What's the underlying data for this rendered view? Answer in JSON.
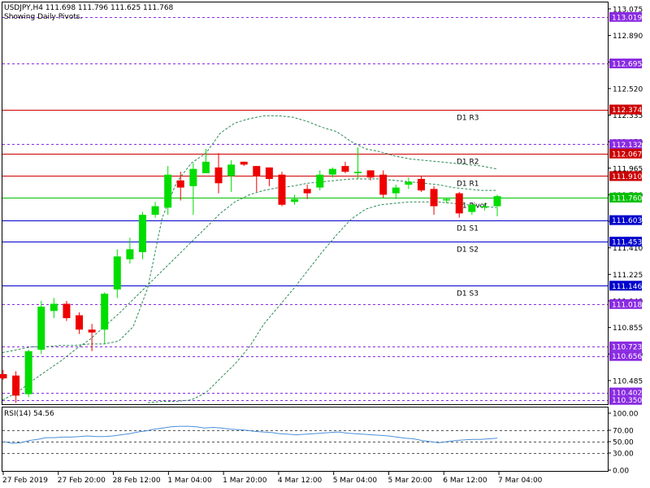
{
  "header": {
    "symbol_line": "USDJPY,H4  111.698 111.796 111.625 111.768",
    "pivot_note": "Showing Daily Pivots.",
    "rsi_label": "RSI(14) 54.56"
  },
  "colors": {
    "bull": "#00dd00",
    "bear": "#ee0000",
    "bollinger": "#2e8b57",
    "pivot_green": "#00c000",
    "support_blue": "#0000cc",
    "resistance_red": "#cc0000",
    "dashed_purple": "#8a2be2",
    "badge_blue": "#0000cc",
    "badge_green": "#00c000",
    "badge_red": "#cc0000",
    "badge_purple": "#8a2be2",
    "rsi_line": "#4a90d9"
  },
  "chart_data": [
    {
      "type": "candlestick",
      "title": "USDJPY,H4",
      "ylim": [
        110.32,
        113.12
      ],
      "y_ticks": [
        "113.075",
        "112.890",
        "112.705",
        "112.520",
        "112.335",
        "112.150",
        "111.965",
        "111.780",
        "111.595",
        "111.410",
        "111.225",
        "111.040",
        "110.855",
        "110.670",
        "110.485"
      ],
      "x_ticks": [
        {
          "label": "27 Feb 2019",
          "index": 0
        },
        {
          "label": "27 Feb 20:00",
          "index": 5
        },
        {
          "label": "28 Feb 12:00",
          "index": 10
        },
        {
          "label": "1 Mar 04:00",
          "index": 15
        },
        {
          "label": "1 Mar 20:00",
          "index": 20
        },
        {
          "label": "4 Mar 12:00",
          "index": 25
        },
        {
          "label": "5 Mar 04:00",
          "index": 30
        },
        {
          "label": "5 Mar 20:00",
          "index": 35
        },
        {
          "label": "6 Mar 12:00",
          "index": 40
        },
        {
          "label": "7 Mar 04:00",
          "index": 45
        }
      ],
      "candles": [
        {
          "o": 110.53,
          "h": 110.56,
          "l": 110.49,
          "c": 110.5
        },
        {
          "o": 110.52,
          "h": 110.55,
          "l": 110.33,
          "c": 110.38
        },
        {
          "o": 110.39,
          "h": 110.7,
          "l": 110.37,
          "c": 110.69
        },
        {
          "o": 110.7,
          "h": 111.04,
          "l": 110.67,
          "c": 111.0
        },
        {
          "o": 110.97,
          "h": 111.06,
          "l": 110.92,
          "c": 111.02
        },
        {
          "o": 111.02,
          "h": 111.04,
          "l": 110.9,
          "c": 110.92
        },
        {
          "o": 110.94,
          "h": 110.96,
          "l": 110.81,
          "c": 110.84
        },
        {
          "o": 110.84,
          "h": 110.88,
          "l": 110.69,
          "c": 110.82
        },
        {
          "o": 110.84,
          "h": 111.1,
          "l": 110.74,
          "c": 111.09
        },
        {
          "o": 111.12,
          "h": 111.4,
          "l": 111.06,
          "c": 111.35
        },
        {
          "o": 111.33,
          "h": 111.48,
          "l": 111.3,
          "c": 111.4
        },
        {
          "o": 111.38,
          "h": 111.66,
          "l": 111.33,
          "c": 111.64
        },
        {
          "o": 111.64,
          "h": 111.73,
          "l": 111.62,
          "c": 111.7
        },
        {
          "o": 111.69,
          "h": 111.98,
          "l": 111.64,
          "c": 111.92
        },
        {
          "o": 111.88,
          "h": 111.94,
          "l": 111.74,
          "c": 111.83
        },
        {
          "o": 111.84,
          "h": 112.0,
          "l": 111.64,
          "c": 111.96
        },
        {
          "o": 111.93,
          "h": 112.1,
          "l": 111.93,
          "c": 112.01
        },
        {
          "o": 111.97,
          "h": 112.07,
          "l": 111.79,
          "c": 111.86
        },
        {
          "o": 111.91,
          "h": 112.02,
          "l": 111.8,
          "c": 111.99
        },
        {
          "o": 112.01,
          "h": 112.01,
          "l": 111.98,
          "c": 111.99
        },
        {
          "o": 111.98,
          "h": 111.98,
          "l": 111.8,
          "c": 111.91
        },
        {
          "o": 111.97,
          "h": 111.97,
          "l": 111.84,
          "c": 111.89
        },
        {
          "o": 111.92,
          "h": 111.94,
          "l": 111.7,
          "c": 111.71
        },
        {
          "o": 111.73,
          "h": 111.78,
          "l": 111.71,
          "c": 111.75
        },
        {
          "o": 111.82,
          "h": 111.85,
          "l": 111.75,
          "c": 111.79
        },
        {
          "o": 111.83,
          "h": 111.95,
          "l": 111.81,
          "c": 111.92
        },
        {
          "o": 111.92,
          "h": 111.97,
          "l": 111.9,
          "c": 111.96
        },
        {
          "o": 111.98,
          "h": 112.01,
          "l": 111.93,
          "c": 111.94
        },
        {
          "o": 111.93,
          "h": 112.11,
          "l": 111.89,
          "c": 111.94
        },
        {
          "o": 111.95,
          "h": 111.95,
          "l": 111.88,
          "c": 111.9
        },
        {
          "o": 111.92,
          "h": 111.95,
          "l": 111.76,
          "c": 111.78
        },
        {
          "o": 111.79,
          "h": 111.85,
          "l": 111.75,
          "c": 111.83
        },
        {
          "o": 111.85,
          "h": 111.9,
          "l": 111.82,
          "c": 111.87
        },
        {
          "o": 111.89,
          "h": 111.91,
          "l": 111.8,
          "c": 111.81
        },
        {
          "o": 111.82,
          "h": 111.84,
          "l": 111.64,
          "c": 111.7
        },
        {
          "o": 111.74,
          "h": 111.76,
          "l": 111.72,
          "c": 111.75
        },
        {
          "o": 111.79,
          "h": 111.8,
          "l": 111.62,
          "c": 111.65
        },
        {
          "o": 111.66,
          "h": 111.72,
          "l": 111.64,
          "c": 111.71
        },
        {
          "o": 111.7,
          "h": 111.72,
          "l": 111.67,
          "c": 111.7
        },
        {
          "o": 111.7,
          "h": 111.78,
          "l": 111.63,
          "c": 111.77
        }
      ],
      "bollinger": {
        "upper": [
          110.68,
          110.7,
          110.72,
          110.72,
          110.73,
          110.73,
          110.74,
          110.74,
          110.76,
          110.86,
          111.13,
          111.62,
          111.87,
          112.0,
          112.07,
          112.21,
          112.28,
          112.31,
          112.33,
          112.33,
          112.32,
          112.29,
          112.25,
          112.22,
          112.15,
          112.1,
          112.08,
          112.05,
          112.03,
          112.02,
          112.01,
          112.0,
          111.99,
          111.98,
          111.96
        ],
        "middle": [
          110.35,
          110.4,
          110.48,
          110.55,
          110.62,
          110.7,
          110.77,
          110.86,
          110.95,
          111.05,
          111.15,
          111.25,
          111.35,
          111.45,
          111.55,
          111.65,
          111.73,
          111.78,
          111.81,
          111.83,
          111.84,
          111.86,
          111.87,
          111.88,
          111.89,
          111.89,
          111.89,
          111.88,
          111.87,
          111.86,
          111.85,
          111.83,
          111.82,
          111.81,
          111.81
        ],
        "lower": [
          110.33,
          110.34,
          110.34,
          110.35,
          110.4,
          110.5,
          110.6,
          110.72,
          110.88,
          111.0,
          111.12,
          111.25,
          111.38,
          111.5,
          111.61,
          111.68,
          111.71,
          111.72,
          111.73,
          111.73,
          111.73,
          111.72,
          111.71,
          111.7,
          111.69
        ],
        "lower_start_index": 16
      },
      "pivot_levels": [
        {
          "label": "D1  R3",
          "value": 112.374,
          "badge": "112.374",
          "kind": "resistance"
        },
        {
          "label": "D1  R2",
          "value": 112.067,
          "badge": "112.067",
          "kind": "resistance"
        },
        {
          "label": "D1  R1",
          "value": 111.91,
          "badge": "111.910",
          "kind": "resistance"
        },
        {
          "label": "D1  Pivot",
          "value": 111.76,
          "badge": "111.760",
          "kind": "pivot"
        },
        {
          "label": "D1  S1",
          "value": 111.603,
          "badge": "111.603",
          "kind": "support"
        },
        {
          "label": "D1  S2",
          "value": 111.453,
          "badge": "111.453",
          "kind": "support"
        },
        {
          "label": "D1  S3",
          "value": 111.146,
          "badge": "111.146",
          "kind": "support"
        }
      ],
      "dashed_levels": [
        {
          "value": 113.019,
          "badge": "113.019"
        },
        {
          "value": 112.695,
          "badge": "112.695"
        },
        {
          "value": 112.132,
          "badge": "112.132"
        },
        {
          "value": 111.018,
          "badge": "111.018"
        },
        {
          "value": 110.723,
          "badge": "110.723"
        },
        {
          "value": 110.656,
          "badge": "110.656"
        },
        {
          "value": 110.402,
          "badge": "110.402"
        },
        {
          "value": 110.35,
          "badge": "110.350"
        }
      ]
    },
    {
      "type": "line",
      "title": "RSI(14) 54.56",
      "ylim": [
        0,
        100
      ],
      "y_ticks": [
        "100.00",
        "70.00",
        "50.00",
        "30.00",
        "0.00"
      ],
      "levels": [
        70,
        50,
        30
      ],
      "values": [
        50,
        47,
        48,
        52,
        54,
        57,
        57,
        58,
        58,
        59,
        60,
        59,
        59,
        60,
        62,
        64,
        67,
        69,
        72,
        74,
        76,
        77,
        77,
        76,
        74,
        75,
        74,
        72,
        71,
        70,
        68,
        67,
        66,
        64,
        63,
        62,
        63,
        64,
        65,
        66,
        67,
        65,
        64,
        63,
        62,
        61,
        60,
        58,
        56,
        55,
        52,
        50,
        48,
        50,
        52,
        53,
        54,
        54,
        55,
        56
      ],
      "x_start": 5,
      "x_end": 612
    }
  ]
}
